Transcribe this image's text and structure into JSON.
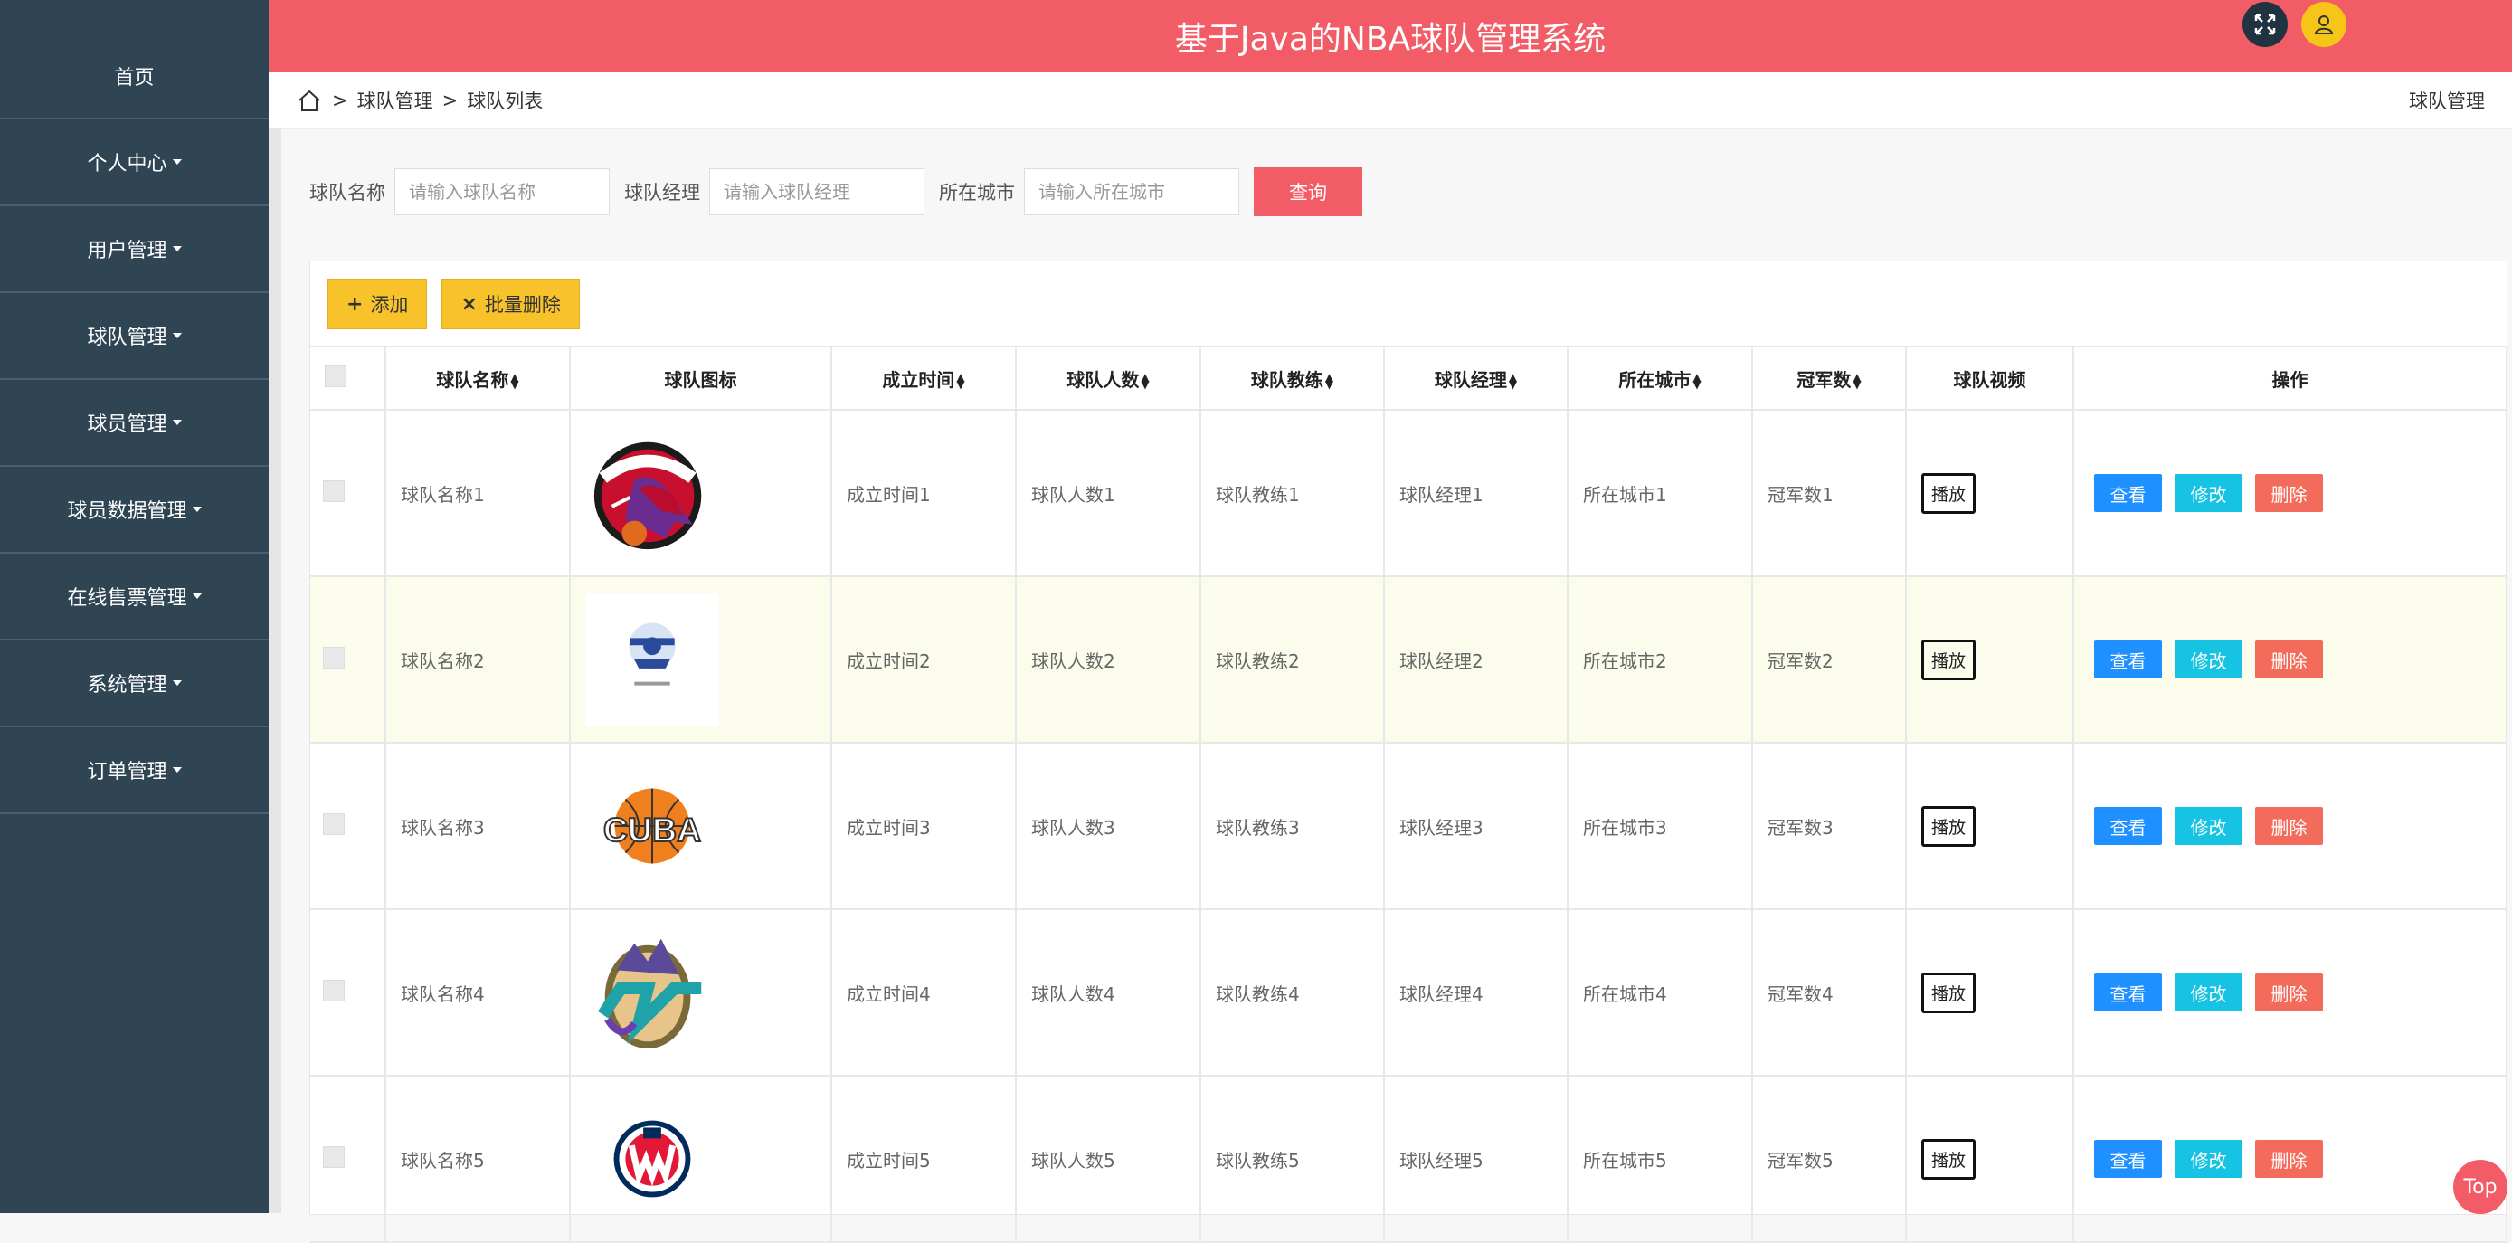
{
  "header": {
    "title": "基于Java的NBA球队管理系统"
  },
  "sidebar": {
    "items": [
      {
        "label": "首页",
        "dropdown": false
      },
      {
        "label": "个人中心",
        "dropdown": true
      },
      {
        "label": "用户管理",
        "dropdown": true
      },
      {
        "label": "球队管理",
        "dropdown": true
      },
      {
        "label": "球员管理",
        "dropdown": true
      },
      {
        "label": "球员数据管理",
        "dropdown": true
      },
      {
        "label": "在线售票管理",
        "dropdown": true
      },
      {
        "label": "系统管理",
        "dropdown": true
      },
      {
        "label": "订单管理",
        "dropdown": true
      }
    ]
  },
  "breadcrumb": {
    "sep": ">",
    "level1": "球队管理",
    "level2": "球队列表",
    "right": "球队管理"
  },
  "search": {
    "name_label": "球队名称",
    "name_placeholder": "请输入球队名称",
    "manager_label": "球队经理",
    "manager_placeholder": "请输入球队经理",
    "city_label": "所在城市",
    "city_placeholder": "请输入所在城市",
    "query_label": "查询"
  },
  "toolbar": {
    "add_label": "添加",
    "batch_delete_label": "批量删除"
  },
  "table": {
    "headers": [
      "球队名称",
      "球队图标",
      "成立时间",
      "球队人数",
      "球队教练",
      "球队经理",
      "所在城市",
      "冠军数",
      "球队视频",
      "操作"
    ],
    "rows": [
      {
        "name": "球队名称1",
        "logo": "raptors",
        "founded": "成立时间1",
        "players": "球队人数1",
        "coach": "球队教练1",
        "manager": "球队经理1",
        "city": "所在城市1",
        "titles": "冠军数1"
      },
      {
        "name": "球队名称2",
        "logo": "pioneers",
        "founded": "成立时间2",
        "players": "球队人数2",
        "coach": "球队教练2",
        "manager": "球队经理2",
        "city": "所在城市2",
        "titles": "冠军数2"
      },
      {
        "name": "球队名称3",
        "logo": "cuba",
        "founded": "成立时间3",
        "players": "球队人数3",
        "coach": "球队教练3",
        "manager": "球队经理3",
        "city": "所在城市3",
        "titles": "冠军数3"
      },
      {
        "name": "球队名称4",
        "logo": "jazz",
        "founded": "成立时间4",
        "players": "球队人数4",
        "coach": "球队教练4",
        "manager": "球队经理4",
        "city": "所在城市4",
        "titles": "冠军数4"
      },
      {
        "name": "球队名称5",
        "logo": "wizards",
        "founded": "成立时间5",
        "players": "球队人数5",
        "coach": "球队教练5",
        "manager": "球队经理5",
        "city": "所在城市5",
        "titles": "冠军数5"
      }
    ],
    "play_label": "播放",
    "view_label": "查看",
    "edit_label": "修改",
    "delete_label": "删除"
  },
  "top_label": "Top",
  "colors": {
    "header": "#f25c67",
    "sidebar": "#2f4554",
    "view": "#1e90ff",
    "edit": "#17c3e2",
    "delete": "#f26b5b",
    "toolbar_btn": "#f7c22a"
  }
}
